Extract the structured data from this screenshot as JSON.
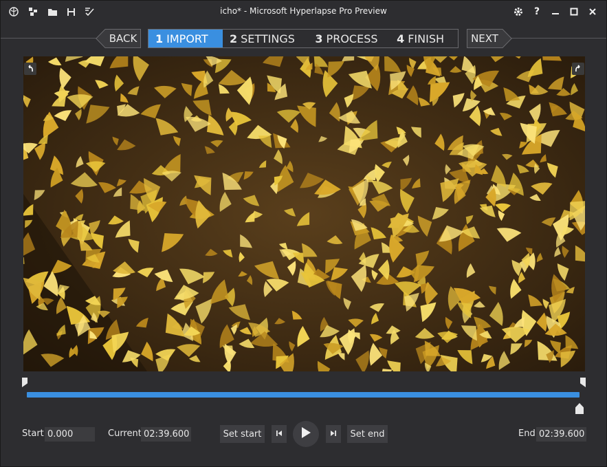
{
  "titlebar": {
    "title": "icho* - Microsoft Hyperlapse Pro Preview",
    "icons": [
      "globe-icon",
      "grid-icon",
      "folder-icon",
      "save-icon",
      "check-edit-icon"
    ],
    "window_buttons": [
      "gear-icon",
      "help-icon",
      "minimize-icon",
      "maximize-icon",
      "close-icon"
    ],
    "help_glyph": "?"
  },
  "wizard": {
    "back_label": "BACK",
    "next_label": "NEXT",
    "steps": [
      {
        "num": "1",
        "label": "IMPORT",
        "active": true
      },
      {
        "num": "2",
        "label": "SETTINGS",
        "active": false
      },
      {
        "num": "3",
        "label": "PROCESS",
        "active": false
      },
      {
        "num": "4",
        "label": "FINISH",
        "active": false
      }
    ]
  },
  "timeline": {
    "progress_fraction": 1.0
  },
  "controls": {
    "start_label": "Start",
    "start_value": "0.000",
    "current_label": "Current",
    "current_value": "02:39.600",
    "set_start_label": "Set start",
    "set_end_label": "Set end",
    "end_label": "End",
    "end_value": "02:39.600"
  },
  "colors": {
    "accent": "#3a8fe0",
    "background": "#2d2d30"
  }
}
